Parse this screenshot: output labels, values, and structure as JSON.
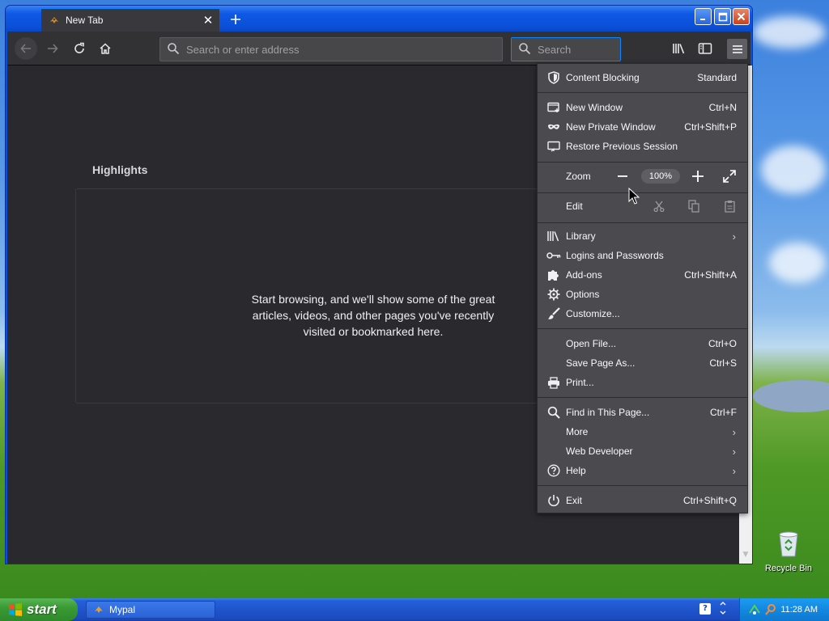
{
  "browser": {
    "tab_title": "New Tab",
    "url_placeholder": "Search or enter address",
    "search_placeholder": "Search"
  },
  "content": {
    "highlights_title": "Highlights",
    "highlights_message": "Start browsing, and we'll show some of the great articles, videos, and other pages you've recently visited or bookmarked here."
  },
  "menu": {
    "content_blocking": {
      "label": "Content Blocking",
      "value": "Standard"
    },
    "new_window": {
      "label": "New Window",
      "shortcut": "Ctrl+N"
    },
    "new_private_window": {
      "label": "New Private Window",
      "shortcut": "Ctrl+Shift+P"
    },
    "restore_session": {
      "label": "Restore Previous Session"
    },
    "zoom": {
      "label": "Zoom",
      "value": "100%"
    },
    "edit": {
      "label": "Edit"
    },
    "library": {
      "label": "Library"
    },
    "logins": {
      "label": "Logins and Passwords"
    },
    "addons": {
      "label": "Add-ons",
      "shortcut": "Ctrl+Shift+A"
    },
    "options": {
      "label": "Options"
    },
    "customize": {
      "label": "Customize..."
    },
    "open_file": {
      "label": "Open File...",
      "shortcut": "Ctrl+O"
    },
    "save_page": {
      "label": "Save Page As...",
      "shortcut": "Ctrl+S"
    },
    "print": {
      "label": "Print..."
    },
    "find": {
      "label": "Find in This Page...",
      "shortcut": "Ctrl+F"
    },
    "more": {
      "label": "More"
    },
    "web_developer": {
      "label": "Web Developer"
    },
    "help": {
      "label": "Help"
    },
    "exit": {
      "label": "Exit",
      "shortcut": "Ctrl+Shift+Q"
    }
  },
  "desktop": {
    "recycle_bin": "Recycle Bin"
  },
  "taskbar": {
    "start": "start",
    "task_label": "Mypal",
    "clock": "11:28 AM"
  },
  "colors": {
    "menu_bg": "#4a4a4f",
    "content_bg": "#2a2a2e",
    "accent": "#0a84ff",
    "xp_title": "#0a50d8",
    "start_green": "#3a9a34"
  }
}
